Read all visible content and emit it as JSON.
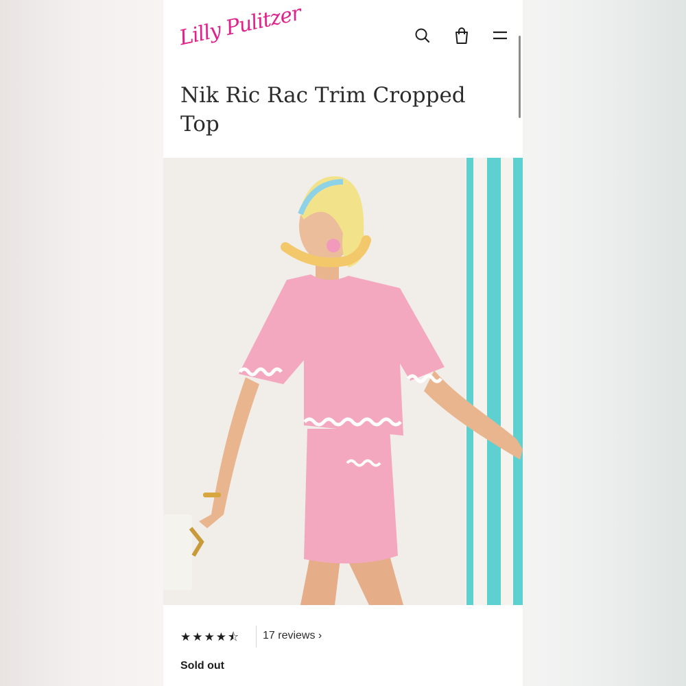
{
  "brand": {
    "logo_text": "Lilly Pulitzer",
    "color": "#e0218a"
  },
  "header": {
    "icons": [
      "search-icon",
      "shopping-bag-icon",
      "menu-icon"
    ]
  },
  "product": {
    "title": "Nik Ric Rac Trim Cropped Top",
    "image_alt": "Model wearing pink Nik Ric Rac Trim Cropped Top with matching skirt and floral headscarf",
    "rating": 4.5,
    "stars_text": "★★★★⯪",
    "reviews_label": "17 reviews ›",
    "status": "Sold out"
  },
  "colors": {
    "top_pink": "#f4a8c0",
    "stripe_teal": "#5fd0d0",
    "text_dark": "#2b2b2b"
  }
}
